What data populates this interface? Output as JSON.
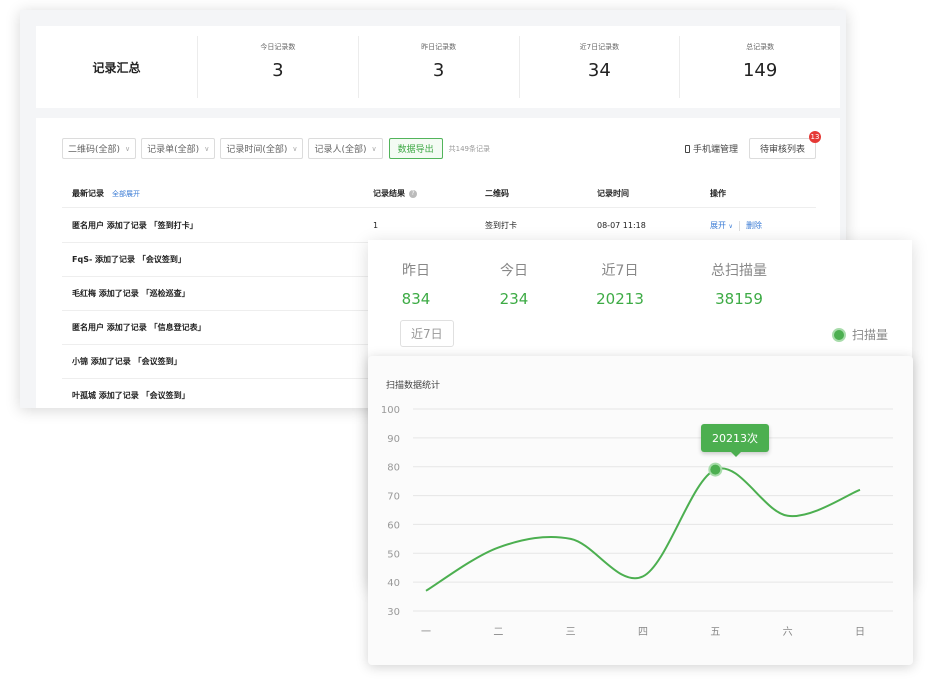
{
  "summary": {
    "title": "记录汇总",
    "stats": [
      {
        "label": "今日记录数",
        "value": "3"
      },
      {
        "label": "昨日记录数",
        "value": "3"
      },
      {
        "label": "近7日记录数",
        "value": "34"
      },
      {
        "label": "总记录数",
        "value": "149"
      }
    ]
  },
  "filters": {
    "qr": "二维码(全部)",
    "form": "记录单(全部)",
    "time": "记录时间(全部)",
    "person": "记录人(全部)",
    "export": "数据导出",
    "total": "共149条记录"
  },
  "tools": {
    "mobile": "手机端管理",
    "review": "待审核列表",
    "badge": "13"
  },
  "table": {
    "headers": {
      "latest": "最新记录",
      "expand_all": "全部展开",
      "result": "记录结果",
      "qr": "二维码",
      "time": "记录时间",
      "ops": "操作"
    },
    "rows": [
      {
        "text": "匿名用户 添加了记录 「签到打卡」",
        "result": "1",
        "qr": "签到打卡",
        "time": "08-07 11:18",
        "expand": "展开",
        "delete": "删除"
      },
      {
        "text": "FqS- 添加了记录 「会议签到」"
      },
      {
        "text": "毛红梅 添加了记录 「巡检巡查」"
      },
      {
        "text": "匿名用户 添加了记录 「信息登记表」"
      },
      {
        "text": "小锦 添加了记录 「会议签到」"
      },
      {
        "text": "叶孤城 添加了记录 「会议签到」"
      }
    ]
  },
  "kpis": [
    {
      "label": "昨日",
      "value": "834"
    },
    {
      "label": "今日",
      "value": "234"
    },
    {
      "label": "近7日",
      "value": "20213"
    },
    {
      "label": "总扫描量",
      "value": "38159"
    }
  ],
  "range_button": "近7日",
  "legend": "扫描量",
  "tooltip": "20213次",
  "colors": {
    "accent": "#4caf50",
    "link": "#3a7bd5",
    "badge": "#e53935"
  },
  "chart_data": {
    "type": "line",
    "title": "扫描数据统计",
    "categories": [
      "一",
      "二",
      "三",
      "四",
      "五",
      "六",
      "日"
    ],
    "series": [
      {
        "values": [
          37,
          52,
          55,
          42,
          79,
          63,
          72
        ]
      }
    ],
    "ylim": [
      30,
      100
    ],
    "yticks": [
      100,
      90,
      80,
      70,
      60,
      50,
      40,
      30
    ],
    "highlight": {
      "x": "五",
      "y": 79
    },
    "grid": true
  }
}
